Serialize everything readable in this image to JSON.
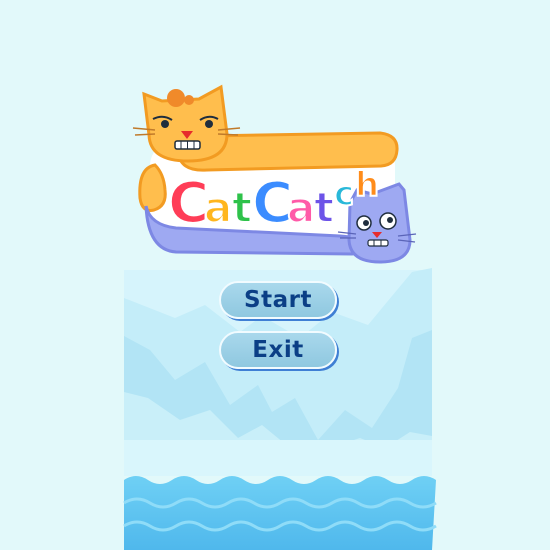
{
  "game": {
    "logo_text": "CatCatch",
    "logo_letters": [
      "C",
      "a",
      "t",
      "C",
      "a",
      "t",
      "c",
      "h"
    ],
    "logo_letter_colors": [
      "#ff3d57",
      "#ffb61e",
      "#2ec24a",
      "#3b8cff",
      "#ff5aa8",
      "#6d53e8",
      "#29b8d9",
      "#ff8c1a"
    ]
  },
  "menu": {
    "start_label": "Start",
    "exit_label": "Exit"
  },
  "colors": {
    "background": "#e2f9fa",
    "button_fill": "#9ccfe6",
    "button_text": "#0b3f86",
    "button_shadow": "#3f7fd4",
    "water": "#5bc6f0",
    "ice": "#c6eef9",
    "orange_cat": "#ffbe4d",
    "blue_cat": "#9ea9f2"
  },
  "icons": [
    "orange-cat-icon",
    "blue-cat-icon"
  ]
}
